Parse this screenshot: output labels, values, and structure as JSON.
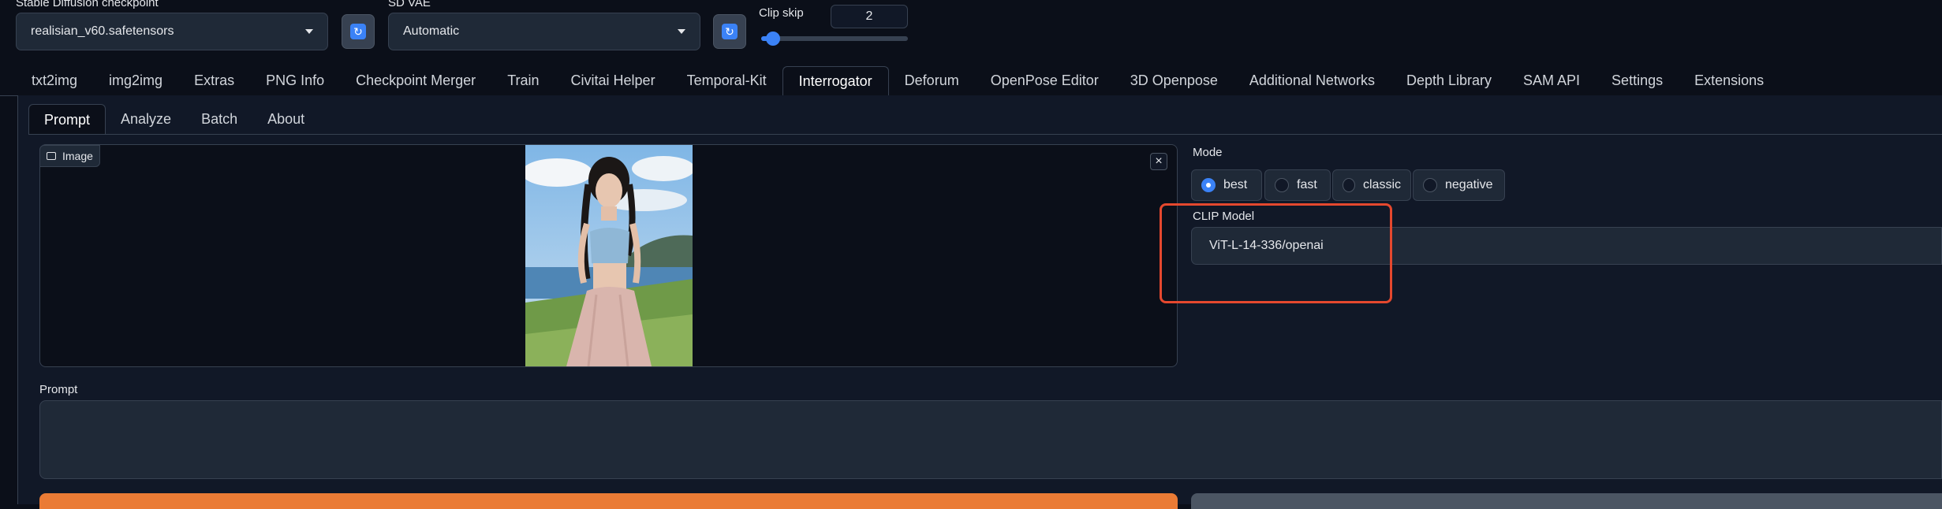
{
  "top_bar": {
    "checkpoint_label": "Stable Diffusion checkpoint",
    "checkpoint_value": "realisian_v60.safetensors",
    "vae_label": "SD VAE",
    "vae_value": "Automatic",
    "clip_skip_label": "Clip skip",
    "clip_skip_value": "2",
    "clip_skip_fraction": 0.08,
    "refresh_icon": "↻"
  },
  "main_tabs": [
    {
      "label": "txt2img"
    },
    {
      "label": "img2img"
    },
    {
      "label": "Extras"
    },
    {
      "label": "PNG Info"
    },
    {
      "label": "Checkpoint Merger"
    },
    {
      "label": "Train"
    },
    {
      "label": "Civitai Helper"
    },
    {
      "label": "Temporal-Kit"
    },
    {
      "label": "Interrogator",
      "active": true
    },
    {
      "label": "Deforum"
    },
    {
      "label": "OpenPose Editor"
    },
    {
      "label": "3D Openpose"
    },
    {
      "label": "Additional Networks"
    },
    {
      "label": "Depth Library"
    },
    {
      "label": "SAM API"
    },
    {
      "label": "Settings"
    },
    {
      "label": "Extensions"
    }
  ],
  "sub_tabs": [
    {
      "label": "Prompt",
      "active": true
    },
    {
      "label": "Analyze"
    },
    {
      "label": "Batch"
    },
    {
      "label": "About"
    }
  ],
  "image_panel": {
    "label": "Image",
    "close_icon": "×"
  },
  "mode": {
    "label": "Mode",
    "options": [
      {
        "label": "best",
        "selected": true
      },
      {
        "label": "fast"
      },
      {
        "label": "classic"
      },
      {
        "label": "negative"
      }
    ]
  },
  "clip_model": {
    "label": "CLIP Model",
    "value": "ViT-L-14-336/openai"
  },
  "prompt": {
    "label": "Prompt",
    "value": ""
  },
  "colors": {
    "accent": "#3b82f6",
    "primary_button": "#ea7b35",
    "highlight_box": "#e5482e"
  }
}
